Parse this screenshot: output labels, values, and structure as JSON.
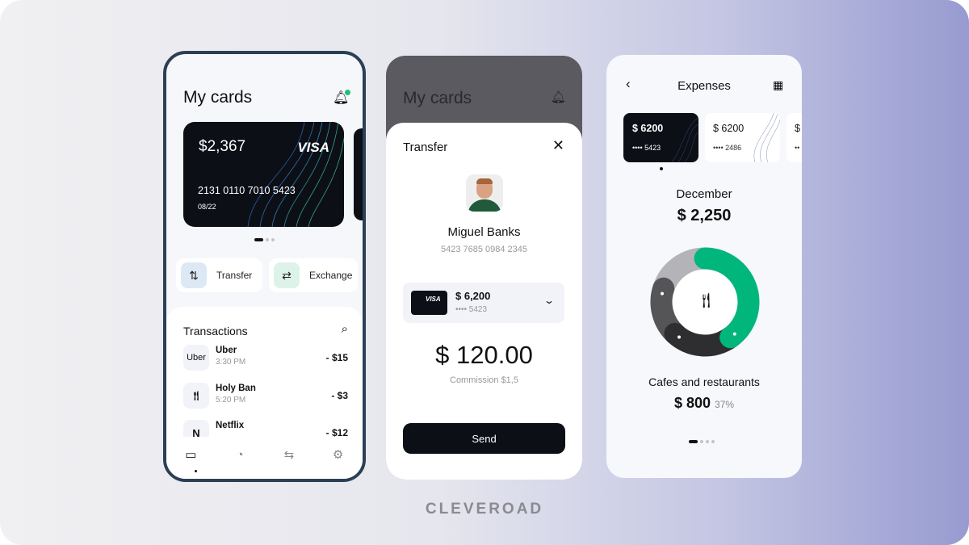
{
  "screen1": {
    "title": "My cards",
    "card": {
      "balance": "$2,367",
      "brand": "VISA",
      "number": "2131 0110 7010 5423",
      "expiry": "08/22"
    },
    "actions": [
      {
        "label": "Transfer",
        "icon": "transfer-arrows-icon"
      },
      {
        "label": "Exchange",
        "icon": "exchange-arrows-icon"
      }
    ],
    "transactions_title": "Transactions",
    "transactions": [
      {
        "name": "Uber",
        "time": "3:30 PM",
        "amount": "- $15",
        "logo": "Uber"
      },
      {
        "name": "Holy Ban",
        "time": "5:20 PM",
        "amount": "- $3",
        "logo": "fork-knife-icon"
      },
      {
        "name": "Netflix",
        "time": "",
        "amount": "- $12",
        "logo": "N"
      }
    ],
    "nav": [
      "cards-icon",
      "chart-icon",
      "exchange-icon",
      "settings-icon"
    ]
  },
  "screen2": {
    "title": "My cards",
    "sheet_title": "Transfer",
    "recipient_name": "Miguel Banks",
    "recipient_card": "5423 7685 0984 2345",
    "source_card": {
      "brand": "VISA",
      "amount": "$ 6,200",
      "last4": "•••• 5423"
    },
    "amount": "$ 120.00",
    "commission": "Commission $1,5",
    "send_label": "Send"
  },
  "screen3": {
    "title": "Expenses",
    "cards": [
      {
        "amount": "$ 6200",
        "last4": "•••• 5423"
      },
      {
        "amount": "$ 6200",
        "last4": "•••• 2486"
      },
      {
        "amount": "$",
        "last4": "••"
      }
    ],
    "month": "December",
    "total": "$ 2,250",
    "category": "Cafes and restaurants",
    "category_amount": "$ 800",
    "category_percent": "37%",
    "segments": [
      {
        "share": 0.4,
        "color": "#00b67a"
      },
      {
        "share": 0.22,
        "color": "#2e2e30"
      },
      {
        "share": 0.18,
        "color": "#555558"
      },
      {
        "share": 0.2,
        "color": "#b4b4b8"
      }
    ]
  },
  "brand_logo": "CLEVEROAD"
}
